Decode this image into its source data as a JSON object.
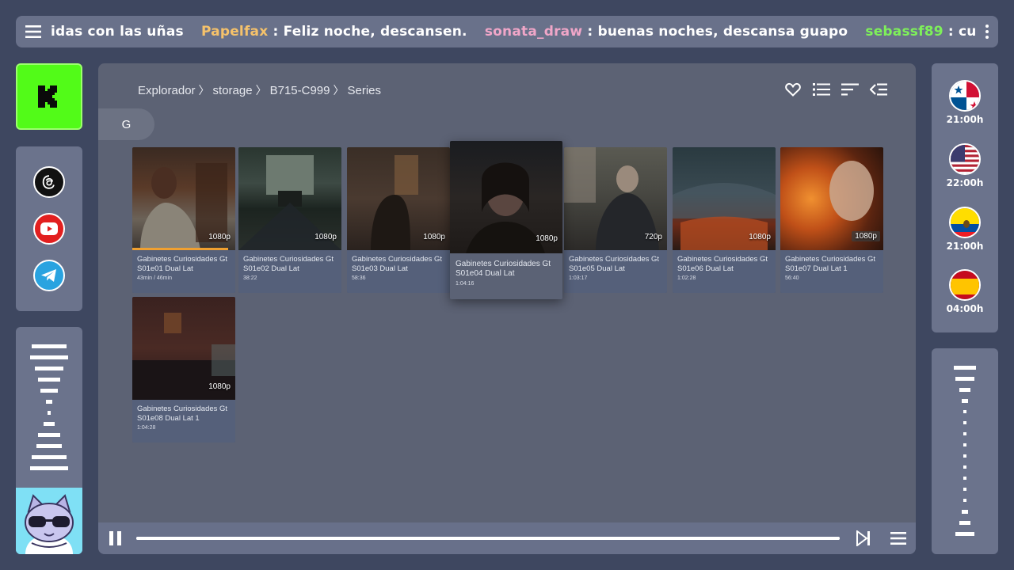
{
  "ticker": {
    "messages": [
      {
        "user": "",
        "user_color": "#ffffff",
        "text": "idas con las uñas"
      },
      {
        "user": "Papelfax",
        "user_color": "#f5c26b",
        "text": " : Feliz noche, descansen."
      },
      {
        "user": "sonata_draw",
        "user_color": "#f0a6c8",
        "text": " : buenas noches, descansa guapo"
      },
      {
        "user": "sebassf89",
        "user_color": "#7ef05a",
        "text": " : cuidense y disfruten del viernes !"
      }
    ]
  },
  "sidebar": {
    "kick_logo": "K",
    "social": [
      {
        "name": "threads",
        "icon": "threads-icon",
        "bg": "#111111"
      },
      {
        "name": "youtube",
        "icon": "youtube-icon",
        "bg": "#e21f1f"
      },
      {
        "name": "telegram",
        "icon": "telegram-icon",
        "bg": "#29a3e0"
      }
    ]
  },
  "clocks": [
    {
      "country": "Panama",
      "time": "21:00h"
    },
    {
      "country": "USA",
      "time": "22:00h"
    },
    {
      "country": "Ecuador",
      "time": "21:00h"
    },
    {
      "country": "Spain",
      "time": "04:00h"
    }
  ],
  "browser": {
    "breadcrumb": [
      "Explorador",
      "storage",
      "B715-C999",
      "Series"
    ],
    "letter_filter": "G",
    "items": [
      {
        "title": "Gabinetes Curiosidades Gt S01e01 Dual Lat",
        "duration": "43min / 46min",
        "resolution": "1080p",
        "progress": 0.93
      },
      {
        "title": "Gabinetes Curiosidades Gt S01e02 Dual Lat",
        "duration": "38:22",
        "resolution": "1080p"
      },
      {
        "title": "Gabinetes Curiosidades Gt S01e03 Dual Lat",
        "duration": "58:36",
        "resolution": "1080p"
      },
      {
        "title": "Gabinetes Curiosidades Gt S01e04 Dual Lat",
        "duration": "1:04:16",
        "resolution": "1080p",
        "focused": true
      },
      {
        "title": "Gabinetes Curiosidades Gt S01e05 Dual Lat",
        "duration": "1:03:17",
        "resolution": "720p"
      },
      {
        "title": "Gabinetes Curiosidades Gt S01e06 Dual Lat",
        "duration": "1:02:28",
        "resolution": "1080p"
      },
      {
        "title": "Gabinetes Curiosidades Gt S01e07 Dual Lat 1",
        "duration": "56:40",
        "resolution": "1080p"
      },
      {
        "title": "Gabinetes Curiosidades Gt S01e08 Dual Lat 1",
        "duration": "1:04:28",
        "resolution": "1080p"
      }
    ]
  },
  "playback": {
    "state": "playing",
    "progress": 1.0
  },
  "colors": {
    "kick_green": "#52fb18",
    "accent_orange": "#f0a030"
  }
}
